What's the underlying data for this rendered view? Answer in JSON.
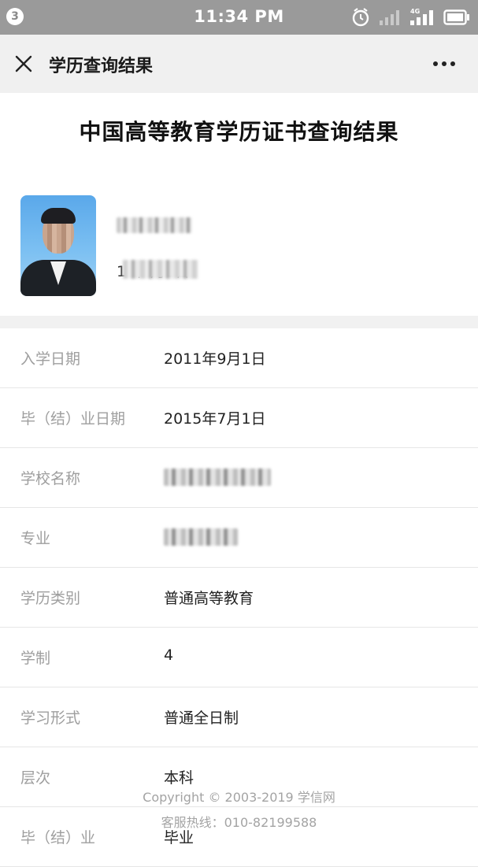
{
  "status_bar": {
    "notification_count": "3",
    "time": "11:34 PM",
    "network": "4G",
    "icons": [
      "alarm-icon",
      "signal-icon",
      "signal-4g-icon",
      "battery-icon"
    ]
  },
  "nav": {
    "title": "学历查询结果",
    "close_icon": "close-icon",
    "more_icon": "more-icon"
  },
  "page": {
    "title": "中国高等教育学历证书查询结果"
  },
  "profile": {
    "name": "",
    "dob": "1     年  月6日"
  },
  "info_rows": [
    {
      "label": "入学日期",
      "value": "2011年9月1日"
    },
    {
      "label": "毕（结）业日期",
      "value": "2015年7月1日"
    },
    {
      "label": "学校名称",
      "value": ""
    },
    {
      "label": "专业",
      "value": ""
    },
    {
      "label": "学历类别",
      "value": "普通高等教育"
    },
    {
      "label": "学制",
      "value": "4"
    },
    {
      "label": "学习形式",
      "value": "普通全日制"
    },
    {
      "label": "层次",
      "value": "本科"
    },
    {
      "label": "毕（结）业",
      "value": "毕业"
    }
  ],
  "footer": {
    "copyright": "Copyright © 2003-2019 学信网",
    "hotline": "客服热线：010-82199588"
  },
  "colors": {
    "status_bar_bg": "#9a9a9a",
    "nav_bg": "#f0f0f0",
    "label_color": "#9e9e9e",
    "value_color": "#222222"
  }
}
